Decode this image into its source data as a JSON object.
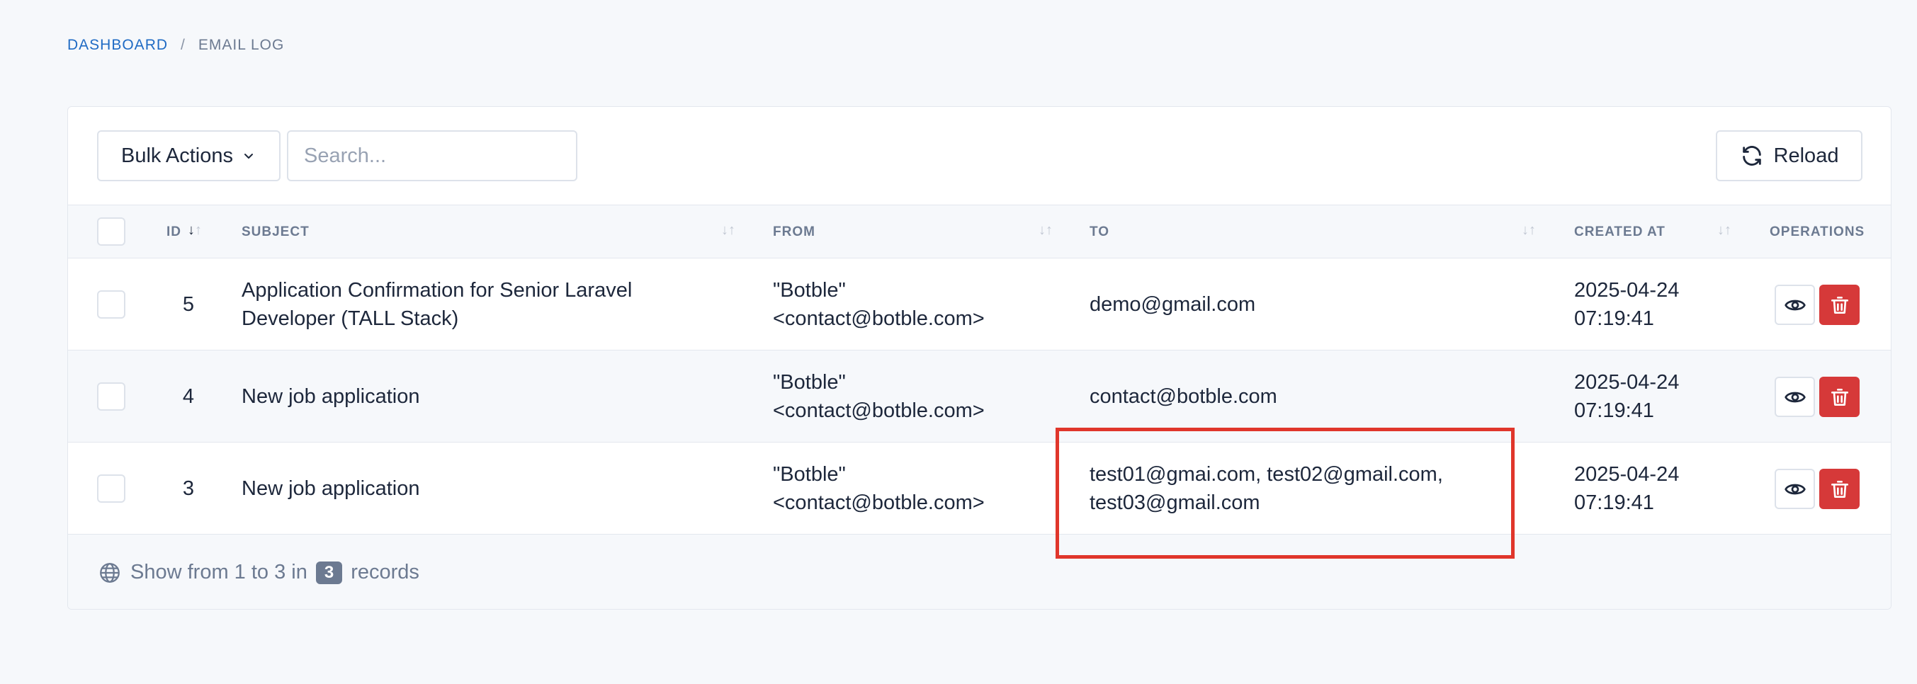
{
  "breadcrumb": {
    "items": [
      "Dashboard",
      "Email Log"
    ],
    "separator": "/"
  },
  "toolbar": {
    "bulk_actions_label": "Bulk Actions",
    "search_placeholder": "Search...",
    "reload_label": "Reload"
  },
  "table": {
    "columns": {
      "id": "ID",
      "subject": "Subject",
      "from": "From",
      "to": "To",
      "created_at": "Created At",
      "operations": "Operations"
    },
    "rows": [
      {
        "id": "5",
        "subject": [
          "Application Confirmation for Senior Laravel",
          "Developer (TALL Stack)"
        ],
        "from": [
          "\"Botble\"",
          "<contact@botble.com>"
        ],
        "to": [
          "demo@gmail.com"
        ],
        "created_at": [
          "2025-04-24",
          "07:19:41"
        ]
      },
      {
        "id": "4",
        "subject": [
          "New job application"
        ],
        "from": [
          "\"Botble\"",
          "<contact@botble.com>"
        ],
        "to": [
          "contact@botble.com"
        ],
        "created_at": [
          "2025-04-24",
          "07:19:41"
        ]
      },
      {
        "id": "3",
        "subject": [
          "New job application"
        ],
        "from": [
          "\"Botble\"",
          "<contact@botble.com>"
        ],
        "to": [
          "test01@gmai.com, test02@gmail.com,",
          "test03@gmail.com"
        ],
        "created_at": [
          "2025-04-24",
          "07:19:41"
        ]
      }
    ]
  },
  "footer": {
    "prefix": "Show from 1 to 3 in",
    "count": "3",
    "suffix": "records"
  },
  "colors": {
    "accent": "#206bc4",
    "danger": "#d63939",
    "highlight_box": "#e0362b"
  },
  "icons": [
    "chevron-down-icon",
    "search-icon",
    "reload-icon",
    "sort-icon",
    "eye-icon",
    "trash-icon",
    "globe-icon"
  ]
}
